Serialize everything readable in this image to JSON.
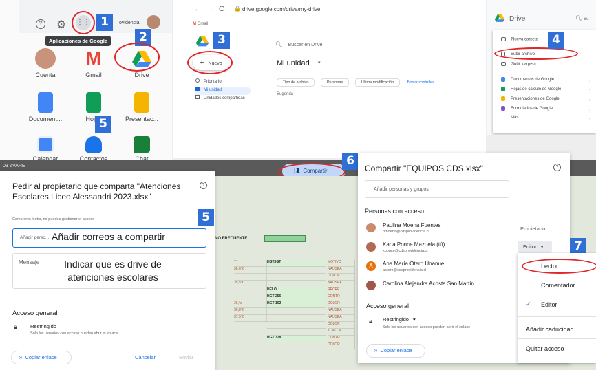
{
  "apps_panel": {
    "top_icons": [
      "help-icon",
      "gear-icon",
      "apps-grid-icon"
    ],
    "profile_text": "ovidencia",
    "tooltip": "Aplicaciones de Google",
    "apps": [
      {
        "label": "Cuenta",
        "icon": "account-icon",
        "color": "#f2c9a8"
      },
      {
        "label": "Gmail",
        "icon": "gmail-icon",
        "color": "#ea4335"
      },
      {
        "label": "Drive",
        "icon": "drive-icon",
        "color": "#1fa463"
      },
      {
        "label": "Document...",
        "icon": "docs-icon",
        "color": "#4285f4"
      },
      {
        "label": "Hojas",
        "icon": "sheets-icon",
        "color": "#0f9d58"
      },
      {
        "label": "Presentac...",
        "icon": "slides-icon",
        "color": "#f4b400"
      },
      {
        "label": "Calendar",
        "icon": "calendar-icon",
        "color": "#4285f4"
      },
      {
        "label": "Contactos",
        "icon": "contacts-icon",
        "color": "#1a73e8"
      },
      {
        "label": "Chat",
        "icon": "chat-icon",
        "color": "#188038"
      }
    ]
  },
  "drive_panel": {
    "url": "drive.google.com/drive/my-drive",
    "gmail_tab": "Gmail",
    "search_placeholder": "Buscar en Drive",
    "new_button": "Nuevo",
    "nav": [
      "Prioritario",
      "Mi unidad",
      "Unidades compartidas"
    ],
    "title": "Mi unidad",
    "filters": [
      "Tipo de archivo",
      "Personas",
      "Última modificación"
    ],
    "clear_filters": "Borrar controles",
    "suggested": "Sugerida"
  },
  "new_menu": {
    "brand": "Drive",
    "search_stub": "Bu",
    "items": [
      "Nueva carpeta",
      "Subir archivo",
      "Subir carpeta",
      "Documentos de Google",
      "Hojas de cálculo de Google",
      "Presentaciones de Google",
      "Formularios de Google",
      "Más"
    ],
    "item_colors": [
      "#5f6368",
      "#5f6368",
      "#5f6368",
      "#4285f4",
      "#0f9d58",
      "#f4b400",
      "#7e57c2",
      "#ffffff"
    ]
  },
  "request_dialog": {
    "title": "Pedir al propietario que comparta \"Atenciones Escolares Liceo Alessandri 2023.xlsx\"",
    "subtitle": "Como eres lector, no puedes gestionar el acceso",
    "input_placeholder": "Añadir perso...",
    "annotation_emails": "Añadir correos a compartir",
    "message_label": "Mensaje",
    "annotation_message": "Indicar que es drive de atenciones escolares",
    "general_access": "Acceso general",
    "restricted": "Restringido",
    "restricted_desc": "Solo los usuarios con acceso pueden abrir el enlace",
    "copy_link": "Copiar enlace",
    "cancel": "Cancelar",
    "send": "Enviar"
  },
  "sheet": {
    "share_button": "Compartir",
    "header_frecuente": "NO FRECUENTE",
    "col_a": [
      "T°",
      "36,6°C",
      "",
      "35,5°C",
      "",
      "",
      "36,°c",
      "36,8°C",
      "37,5°C"
    ],
    "col_b": [
      "HGT/IGT",
      "",
      "",
      "",
      "HELO",
      "HGT 256",
      "HGT 102",
      "",
      "",
      "",
      "",
      "HGT 328"
    ],
    "col_c": [
      "MOTIVO",
      "NAUSEA",
      "DOLOR",
      "NAUSEA",
      "RECRE",
      "CONTR",
      "DOLOR",
      "NAUSEA",
      "NAUSEA",
      "DOLOR",
      "TOALLA",
      "CONTR",
      "DOLOR"
    ],
    "tab_label": "03 ZVARE"
  },
  "share_dialog": {
    "title": "Compartir \"EQUIPOS CDS.xlsx\"",
    "add_placeholder": "Añadir personas y grupos",
    "people_header": "Personas con acceso",
    "people": [
      {
        "name": "Paulina Moena Fuentes",
        "email": "pmoena@cdsprovidencia.cl",
        "role": "Propietario",
        "avatar_color": "#c98b6b"
      },
      {
        "name": "Karla Ponce Mazuela (tú)",
        "email": "kponce@cdsprovidencia.cl",
        "role": "",
        "avatar_color": "#b26a52"
      },
      {
        "name": "Ana María Otero Unanue",
        "email": "aotero@cdsprovidencia.cl",
        "role": "",
        "avatar_color": "#e8710a"
      },
      {
        "name": "Carolina Alejandra Acosta San Martín",
        "email": "",
        "role": "",
        "avatar_color": "#a0584a"
      }
    ],
    "editor_label": "Editor",
    "general_access": "Acceso general",
    "restricted": "Restringido",
    "restricted_desc": "Solo los usuarios con acceso pueden abrir el enlace",
    "copy_link": "Copiar enlace",
    "help_icon": "help-icon"
  },
  "role_menu": {
    "items": [
      "Lector",
      "Comentador",
      "Editor",
      "Añadir caducidad",
      "Quitar acceso"
    ],
    "checked": "Editor"
  },
  "steps": [
    "1",
    "2",
    "3",
    "4",
    "5",
    "5",
    "6",
    "7"
  ],
  "colors": {
    "step_blue": "#2f6fd6",
    "red_ring": "#e0262b",
    "accent_blue": "#1a73e8"
  }
}
